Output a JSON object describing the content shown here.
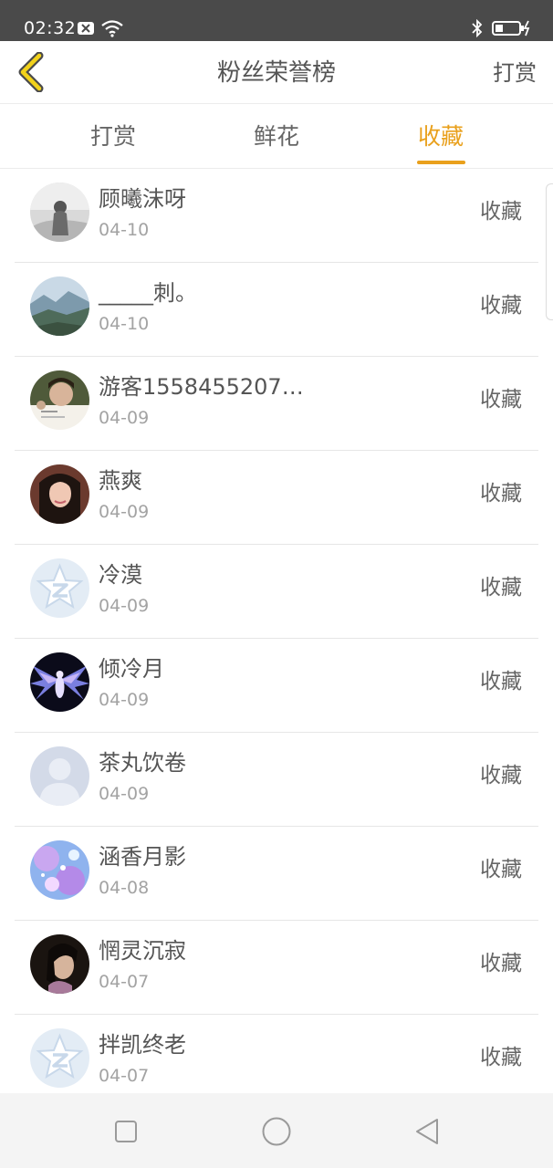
{
  "status_bar": {
    "time": "02:32",
    "icons": [
      "notification-x-icon",
      "wifi-icon",
      "bluetooth-icon",
      "battery-charging-icon"
    ]
  },
  "header": {
    "back_icon": "chevron-left-icon",
    "title": "粉丝荣誉榜",
    "right_action": "打赏"
  },
  "tabs": [
    {
      "label": "打赏",
      "active": false
    },
    {
      "label": "鲜花",
      "active": false
    },
    {
      "label": "收藏",
      "active": true
    }
  ],
  "accent_color": "#e9a01c",
  "fans": [
    {
      "name": "顾曦沫呀",
      "date": "04-10",
      "action": "收藏",
      "avatar": "photo-bw-portrait"
    },
    {
      "name": "_____刺。",
      "date": "04-10",
      "action": "收藏",
      "avatar": "photo-mountain"
    },
    {
      "name": "游客1558455207…",
      "date": "04-09",
      "action": "收藏",
      "avatar": "photo-boy"
    },
    {
      "name": "燕爽",
      "date": "04-09",
      "action": "收藏",
      "avatar": "photo-girl"
    },
    {
      "name": "冷漠",
      "date": "04-09",
      "action": "收藏",
      "avatar": "default-qzone-star"
    },
    {
      "name": "倾冷月",
      "date": "04-09",
      "action": "收藏",
      "avatar": "photo-angel-wings"
    },
    {
      "name": "茶丸饮卷",
      "date": "04-09",
      "action": "收藏",
      "avatar": "default-person"
    },
    {
      "name": "涵香月影",
      "date": "04-08",
      "action": "收藏",
      "avatar": "photo-blue-sparkle"
    },
    {
      "name": "惘灵沉寂",
      "date": "04-07",
      "action": "收藏",
      "avatar": "photo-dark-figure"
    },
    {
      "name": "拌凯终老",
      "date": "04-07",
      "action": "收藏",
      "avatar": "default-qzone-star"
    }
  ],
  "nav_bar": {
    "icons": [
      "recents-square-icon",
      "home-circle-icon",
      "back-triangle-icon"
    ]
  }
}
